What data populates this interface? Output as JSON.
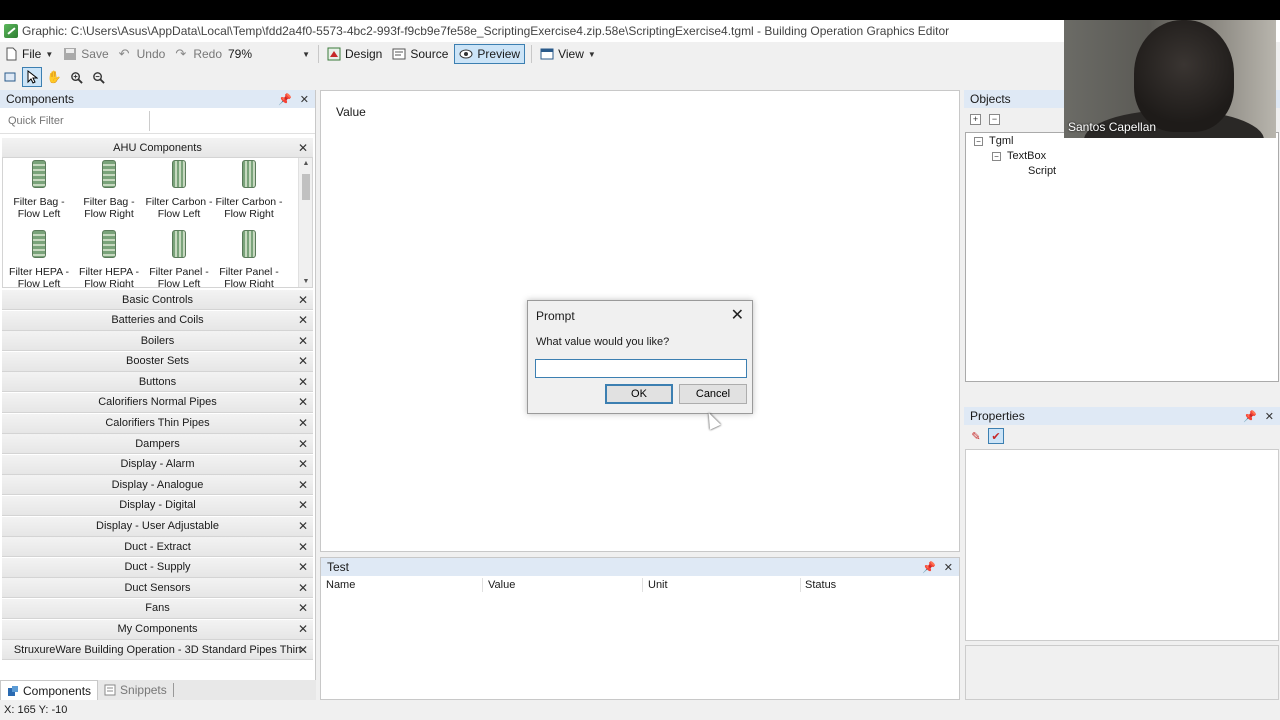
{
  "window": {
    "title": "Graphic: C:\\Users\\Asus\\AppData\\Local\\Temp\\fdd2a4f0-5573-4bc2-993f-f9cb9e7fe58e_ScriptingExercise4.zip.58e\\ScriptingExercise4.tgml - Building Operation Graphics Editor"
  },
  "toolbar": {
    "file": "File",
    "save": "Save",
    "undo": "Undo",
    "redo": "Redo",
    "zoom": "79%",
    "design": "Design",
    "source": "Source",
    "preview": "Preview",
    "view": "View"
  },
  "components": {
    "title": "Components",
    "filter_placeholder": "Quick Filter",
    "ahu": {
      "title": "AHU Components",
      "items": [
        {
          "label": "Filter Bag - Flow Left"
        },
        {
          "label": "Filter Bag - Flow Right"
        },
        {
          "label": "Filter Carbon - Flow Left"
        },
        {
          "label": "Filter Carbon - Flow Right"
        },
        {
          "label": "Filter HEPA - Flow Left"
        },
        {
          "label": "Filter HEPA - Flow Right"
        },
        {
          "label": "Filter Panel - Flow Left"
        },
        {
          "label": "Filter Panel - Flow Right"
        }
      ]
    },
    "categories": [
      "Basic Controls",
      "Batteries and Coils",
      "Boilers",
      "Booster Sets",
      "Buttons",
      "Calorifiers Normal Pipes",
      "Calorifiers Thin Pipes",
      "Dampers",
      "Display - Alarm",
      "Display - Analogue",
      "Display - Digital",
      "Display - User Adjustable",
      "Duct - Extract",
      "Duct - Supply",
      "Duct Sensors",
      "Fans",
      "My Components",
      "StruxureWare Building Operation - 3D Standard Pipes Thin"
    ],
    "tabs": [
      "Components",
      "Snippets"
    ]
  },
  "canvas": {
    "value_label": "Value"
  },
  "prompt": {
    "title": "Prompt",
    "message": "What value would you like?",
    "input_value": "",
    "ok": "OK",
    "cancel": "Cancel"
  },
  "test_panel": {
    "title": "Test",
    "columns": [
      "Name",
      "Value",
      "Unit",
      "Status"
    ]
  },
  "objects": {
    "title": "Objects",
    "tree": [
      "Tgml",
      "TextBox",
      "Script"
    ]
  },
  "properties": {
    "title": "Properties"
  },
  "statusbar": {
    "coords": "X: 165  Y: -10"
  },
  "webcam": {
    "name": "Santos Capellan"
  },
  "colors": {
    "panel_header": "#dfe9f5",
    "active_button": "#cce4f7",
    "accent": "#3c7fb1"
  }
}
